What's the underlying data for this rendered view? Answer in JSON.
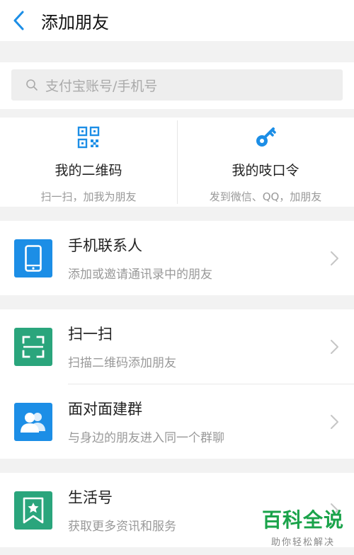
{
  "header": {
    "title": "添加朋友",
    "back_icon": "chevron-left-icon"
  },
  "search": {
    "placeholder": "支付宝账号/手机号",
    "icon": "search-icon"
  },
  "quick_actions": [
    {
      "name": "我的二维码",
      "desc": "扫一扫，加我为朋友",
      "icon": "qr-code-icon"
    },
    {
      "name": "我的吱口令",
      "desc": "发到微信、QQ，加朋友",
      "icon": "key-icon"
    }
  ],
  "rows": [
    {
      "title": "手机联系人",
      "subtitle": "添加或邀请通讯录中的朋友",
      "icon": "phone-icon",
      "color": "#1c8ee6"
    },
    {
      "title": "扫一扫",
      "subtitle": "扫描二维码添加朋友",
      "icon": "scan-icon",
      "color": "#2aa57c"
    },
    {
      "title": "面对面建群",
      "subtitle": "与身边的朋友进入同一个群聊",
      "icon": "group-icon",
      "color": "#1c8ee6"
    },
    {
      "title": "生活号",
      "subtitle": "获取更多资讯和服务",
      "icon": "bookmark-star-icon",
      "color": "#2aa57c"
    }
  ],
  "watermark": {
    "main": "百科全说",
    "sub": "助你轻松解决"
  },
  "colors": {
    "accent": "#1c8ee6",
    "green": "#2aa57c"
  }
}
